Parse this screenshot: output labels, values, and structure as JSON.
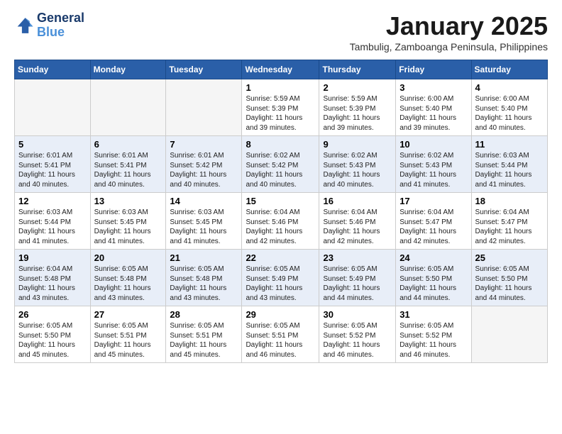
{
  "header": {
    "logo_line1": "General",
    "logo_line2": "Blue",
    "month": "January 2025",
    "location": "Tambulig, Zamboanga Peninsula, Philippines"
  },
  "weekdays": [
    "Sunday",
    "Monday",
    "Tuesday",
    "Wednesday",
    "Thursday",
    "Friday",
    "Saturday"
  ],
  "weeks": [
    [
      {
        "day": "",
        "sunrise": "",
        "sunset": "",
        "daylight": ""
      },
      {
        "day": "",
        "sunrise": "",
        "sunset": "",
        "daylight": ""
      },
      {
        "day": "",
        "sunrise": "",
        "sunset": "",
        "daylight": ""
      },
      {
        "day": "1",
        "sunrise": "Sunrise: 5:59 AM",
        "sunset": "Sunset: 5:39 PM",
        "daylight": "Daylight: 11 hours and 39 minutes."
      },
      {
        "day": "2",
        "sunrise": "Sunrise: 5:59 AM",
        "sunset": "Sunset: 5:39 PM",
        "daylight": "Daylight: 11 hours and 39 minutes."
      },
      {
        "day": "3",
        "sunrise": "Sunrise: 6:00 AM",
        "sunset": "Sunset: 5:40 PM",
        "daylight": "Daylight: 11 hours and 39 minutes."
      },
      {
        "day": "4",
        "sunrise": "Sunrise: 6:00 AM",
        "sunset": "Sunset: 5:40 PM",
        "daylight": "Daylight: 11 hours and 40 minutes."
      }
    ],
    [
      {
        "day": "5",
        "sunrise": "Sunrise: 6:01 AM",
        "sunset": "Sunset: 5:41 PM",
        "daylight": "Daylight: 11 hours and 40 minutes."
      },
      {
        "day": "6",
        "sunrise": "Sunrise: 6:01 AM",
        "sunset": "Sunset: 5:41 PM",
        "daylight": "Daylight: 11 hours and 40 minutes."
      },
      {
        "day": "7",
        "sunrise": "Sunrise: 6:01 AM",
        "sunset": "Sunset: 5:42 PM",
        "daylight": "Daylight: 11 hours and 40 minutes."
      },
      {
        "day": "8",
        "sunrise": "Sunrise: 6:02 AM",
        "sunset": "Sunset: 5:42 PM",
        "daylight": "Daylight: 11 hours and 40 minutes."
      },
      {
        "day": "9",
        "sunrise": "Sunrise: 6:02 AM",
        "sunset": "Sunset: 5:43 PM",
        "daylight": "Daylight: 11 hours and 40 minutes."
      },
      {
        "day": "10",
        "sunrise": "Sunrise: 6:02 AM",
        "sunset": "Sunset: 5:43 PM",
        "daylight": "Daylight: 11 hours and 41 minutes."
      },
      {
        "day": "11",
        "sunrise": "Sunrise: 6:03 AM",
        "sunset": "Sunset: 5:44 PM",
        "daylight": "Daylight: 11 hours and 41 minutes."
      }
    ],
    [
      {
        "day": "12",
        "sunrise": "Sunrise: 6:03 AM",
        "sunset": "Sunset: 5:44 PM",
        "daylight": "Daylight: 11 hours and 41 minutes."
      },
      {
        "day": "13",
        "sunrise": "Sunrise: 6:03 AM",
        "sunset": "Sunset: 5:45 PM",
        "daylight": "Daylight: 11 hours and 41 minutes."
      },
      {
        "day": "14",
        "sunrise": "Sunrise: 6:03 AM",
        "sunset": "Sunset: 5:45 PM",
        "daylight": "Daylight: 11 hours and 41 minutes."
      },
      {
        "day": "15",
        "sunrise": "Sunrise: 6:04 AM",
        "sunset": "Sunset: 5:46 PM",
        "daylight": "Daylight: 11 hours and 42 minutes."
      },
      {
        "day": "16",
        "sunrise": "Sunrise: 6:04 AM",
        "sunset": "Sunset: 5:46 PM",
        "daylight": "Daylight: 11 hours and 42 minutes."
      },
      {
        "day": "17",
        "sunrise": "Sunrise: 6:04 AM",
        "sunset": "Sunset: 5:47 PM",
        "daylight": "Daylight: 11 hours and 42 minutes."
      },
      {
        "day": "18",
        "sunrise": "Sunrise: 6:04 AM",
        "sunset": "Sunset: 5:47 PM",
        "daylight": "Daylight: 11 hours and 42 minutes."
      }
    ],
    [
      {
        "day": "19",
        "sunrise": "Sunrise: 6:04 AM",
        "sunset": "Sunset: 5:48 PM",
        "daylight": "Daylight: 11 hours and 43 minutes."
      },
      {
        "day": "20",
        "sunrise": "Sunrise: 6:05 AM",
        "sunset": "Sunset: 5:48 PM",
        "daylight": "Daylight: 11 hours and 43 minutes."
      },
      {
        "day": "21",
        "sunrise": "Sunrise: 6:05 AM",
        "sunset": "Sunset: 5:48 PM",
        "daylight": "Daylight: 11 hours and 43 minutes."
      },
      {
        "day": "22",
        "sunrise": "Sunrise: 6:05 AM",
        "sunset": "Sunset: 5:49 PM",
        "daylight": "Daylight: 11 hours and 43 minutes."
      },
      {
        "day": "23",
        "sunrise": "Sunrise: 6:05 AM",
        "sunset": "Sunset: 5:49 PM",
        "daylight": "Daylight: 11 hours and 44 minutes."
      },
      {
        "day": "24",
        "sunrise": "Sunrise: 6:05 AM",
        "sunset": "Sunset: 5:50 PM",
        "daylight": "Daylight: 11 hours and 44 minutes."
      },
      {
        "day": "25",
        "sunrise": "Sunrise: 6:05 AM",
        "sunset": "Sunset: 5:50 PM",
        "daylight": "Daylight: 11 hours and 44 minutes."
      }
    ],
    [
      {
        "day": "26",
        "sunrise": "Sunrise: 6:05 AM",
        "sunset": "Sunset: 5:50 PM",
        "daylight": "Daylight: 11 hours and 45 minutes."
      },
      {
        "day": "27",
        "sunrise": "Sunrise: 6:05 AM",
        "sunset": "Sunset: 5:51 PM",
        "daylight": "Daylight: 11 hours and 45 minutes."
      },
      {
        "day": "28",
        "sunrise": "Sunrise: 6:05 AM",
        "sunset": "Sunset: 5:51 PM",
        "daylight": "Daylight: 11 hours and 45 minutes."
      },
      {
        "day": "29",
        "sunrise": "Sunrise: 6:05 AM",
        "sunset": "Sunset: 5:51 PM",
        "daylight": "Daylight: 11 hours and 46 minutes."
      },
      {
        "day": "30",
        "sunrise": "Sunrise: 6:05 AM",
        "sunset": "Sunset: 5:52 PM",
        "daylight": "Daylight: 11 hours and 46 minutes."
      },
      {
        "day": "31",
        "sunrise": "Sunrise: 6:05 AM",
        "sunset": "Sunset: 5:52 PM",
        "daylight": "Daylight: 11 hours and 46 minutes."
      },
      {
        "day": "",
        "sunrise": "",
        "sunset": "",
        "daylight": ""
      }
    ]
  ]
}
